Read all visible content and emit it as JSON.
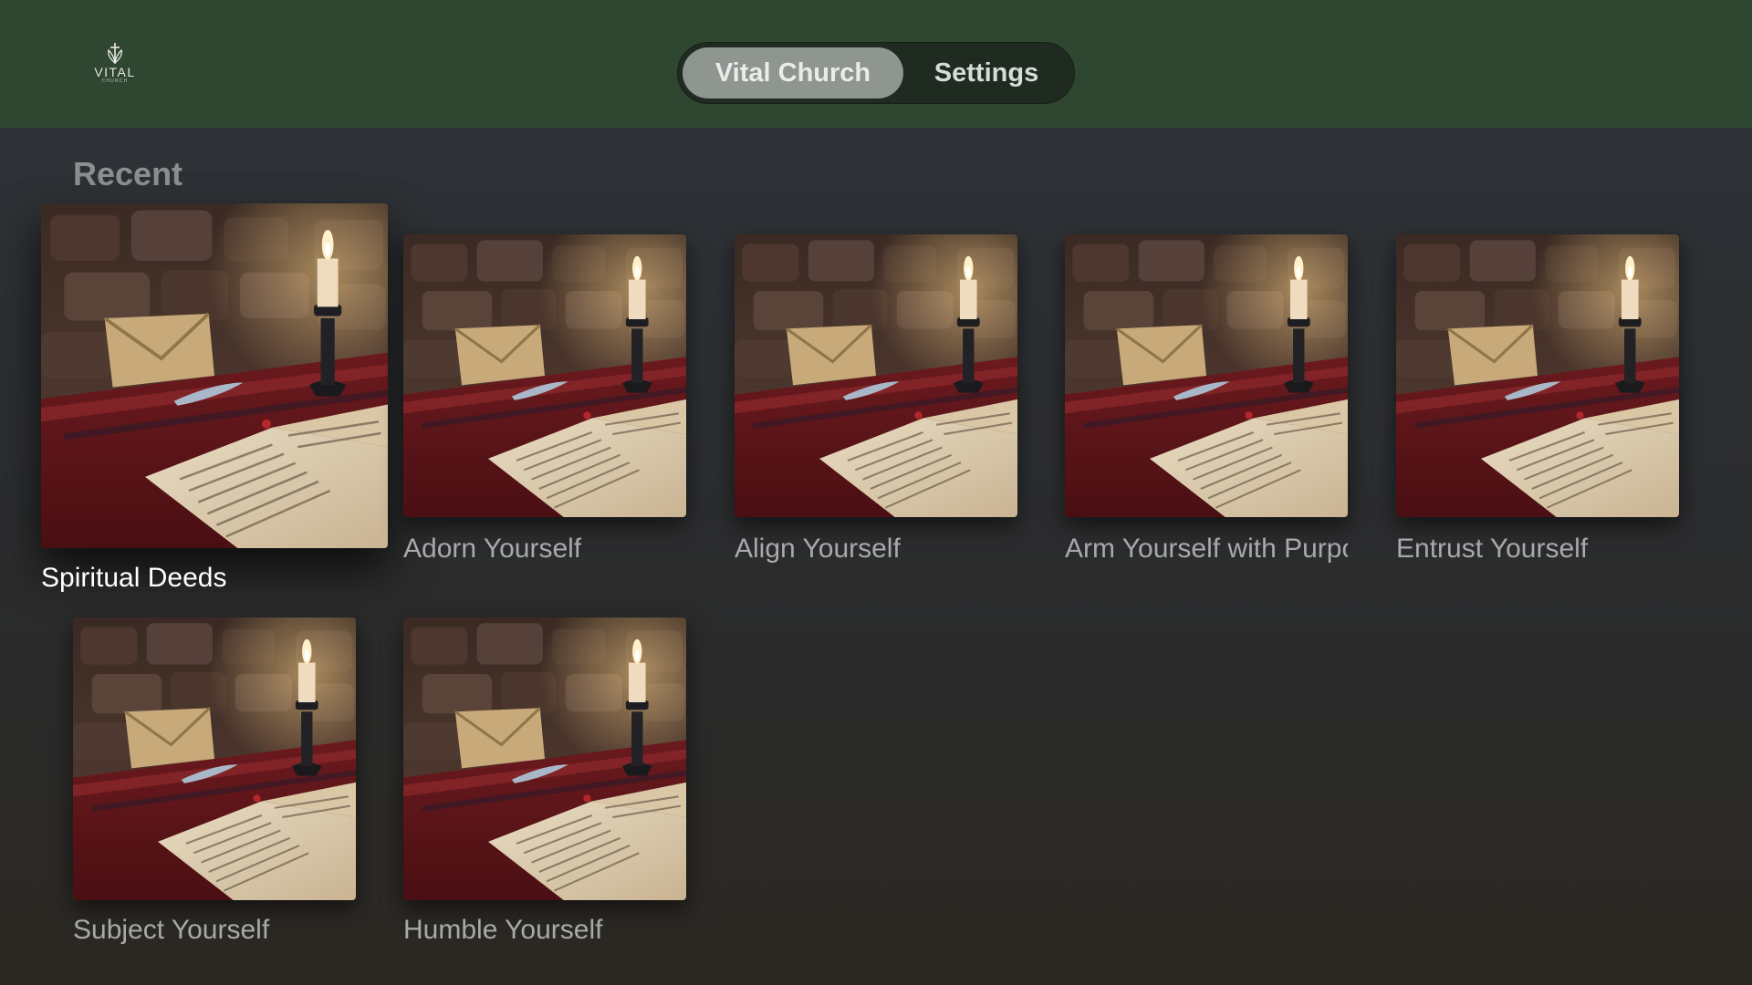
{
  "brand": {
    "name": "VITAL",
    "sub": "CHURCH"
  },
  "tabs": [
    {
      "label": "Vital Church",
      "active": true
    },
    {
      "label": "Settings",
      "active": false
    }
  ],
  "section": {
    "title": "Recent"
  },
  "items": [
    {
      "title": "Spiritual Deeds",
      "focused": true
    },
    {
      "title": "Adorn Yourself"
    },
    {
      "title": "Align Yourself"
    },
    {
      "title": "Arm Yourself with Purpose"
    },
    {
      "title": "Entrust Yourself"
    },
    {
      "title": "Subject Yourself"
    },
    {
      "title": "Humble Yourself"
    }
  ],
  "colors": {
    "header": "#2f4630",
    "active_tab": "#8f9691"
  }
}
